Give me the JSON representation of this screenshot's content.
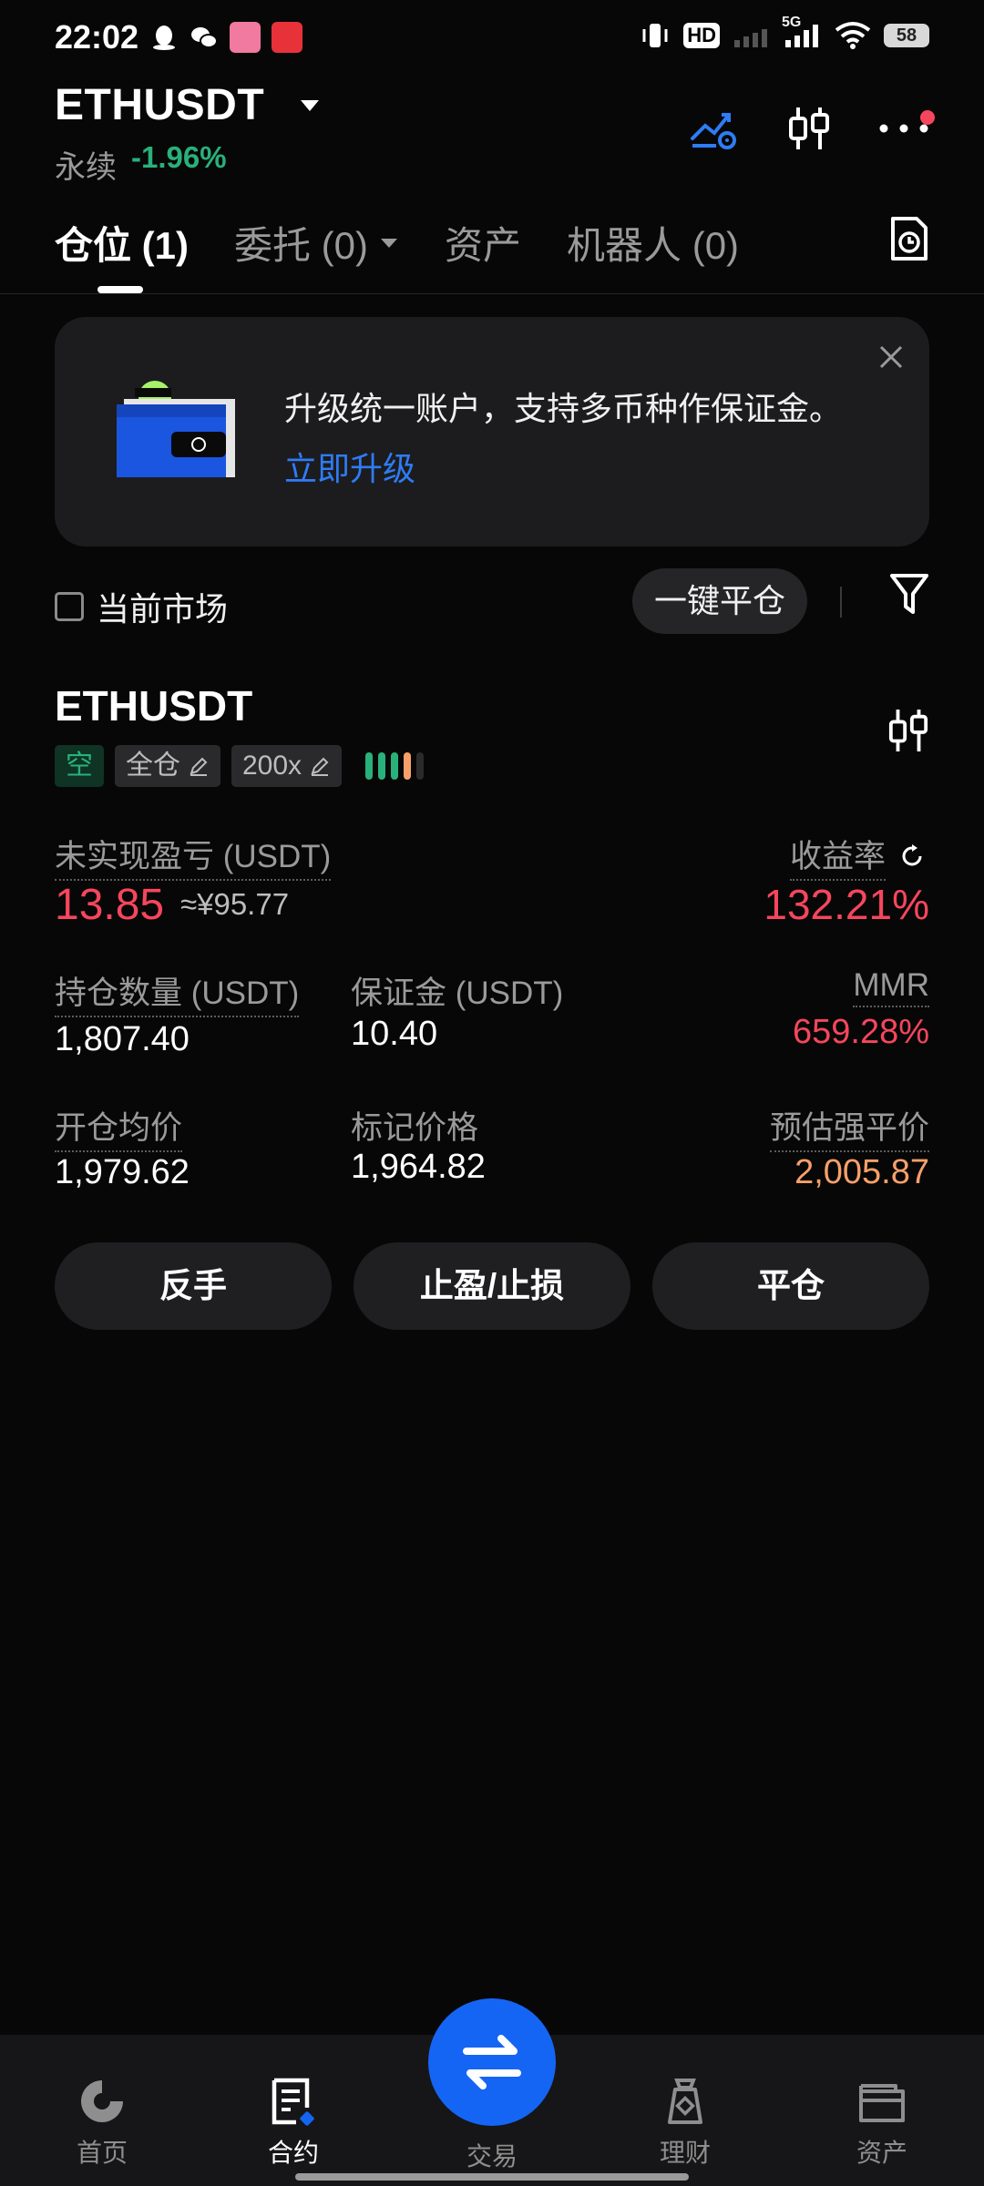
{
  "status_bar": {
    "time": "22:02",
    "network_hd": "HD",
    "network_type": "5G",
    "battery": "58"
  },
  "header": {
    "symbol": "ETHUSDT",
    "contract_type": "永续",
    "change": "-1.96%",
    "icons": [
      "strategy-icon",
      "candlestick-icon",
      "more-icon"
    ]
  },
  "tabs": [
    {
      "label": "仓位 (1)",
      "active": true
    },
    {
      "label": "委托 (0)",
      "active": false,
      "has_dropdown": true
    },
    {
      "label": "资产",
      "active": false
    },
    {
      "label": "机器人 (0)",
      "active": false
    }
  ],
  "banner": {
    "text": "升级统一账户，支持多币种作保证金。",
    "link": "立即升级"
  },
  "filter_row": {
    "current_market_label": "当前市场",
    "current_market_checked": false,
    "close_all_label": "一键平仓"
  },
  "position": {
    "symbol": "ETHUSDT",
    "side_tag": "空",
    "margin_mode": "全仓",
    "leverage": "200x",
    "risk_level": 4,
    "unrealized_pnl_label": "未实现盈亏 (USDT)",
    "unrealized_pnl": "13.85",
    "unrealized_pnl_cny": "≈¥95.77",
    "roi_label": "收益率",
    "roi": "132.21%",
    "size_label": "持仓数量 (USDT)",
    "size": "1,807.40",
    "margin_label": "保证金 (USDT)",
    "margin": "10.40",
    "mmr_label": "MMR",
    "mmr": "659.28%",
    "entry_label": "开仓均价",
    "entry": "1,979.62",
    "mark_label": "标记价格",
    "mark": "1,964.82",
    "liq_label": "预估强平价",
    "liq": "2,005.87",
    "actions": [
      "反手",
      "止盈/止损",
      "平仓"
    ]
  },
  "colors": {
    "green": "#28b17a",
    "red": "#f6465d",
    "orange": "#f7a06a",
    "accent_blue": "#1565f4"
  },
  "bottom_nav": {
    "items": [
      {
        "label": "首页",
        "icon": "home-icon"
      },
      {
        "label": "合约",
        "icon": "futures-icon",
        "active": true
      },
      {
        "label": "交易",
        "icon": "trade-swap-icon"
      },
      {
        "label": "理财",
        "icon": "earn-icon"
      },
      {
        "label": "资产",
        "icon": "assets-icon"
      }
    ]
  }
}
